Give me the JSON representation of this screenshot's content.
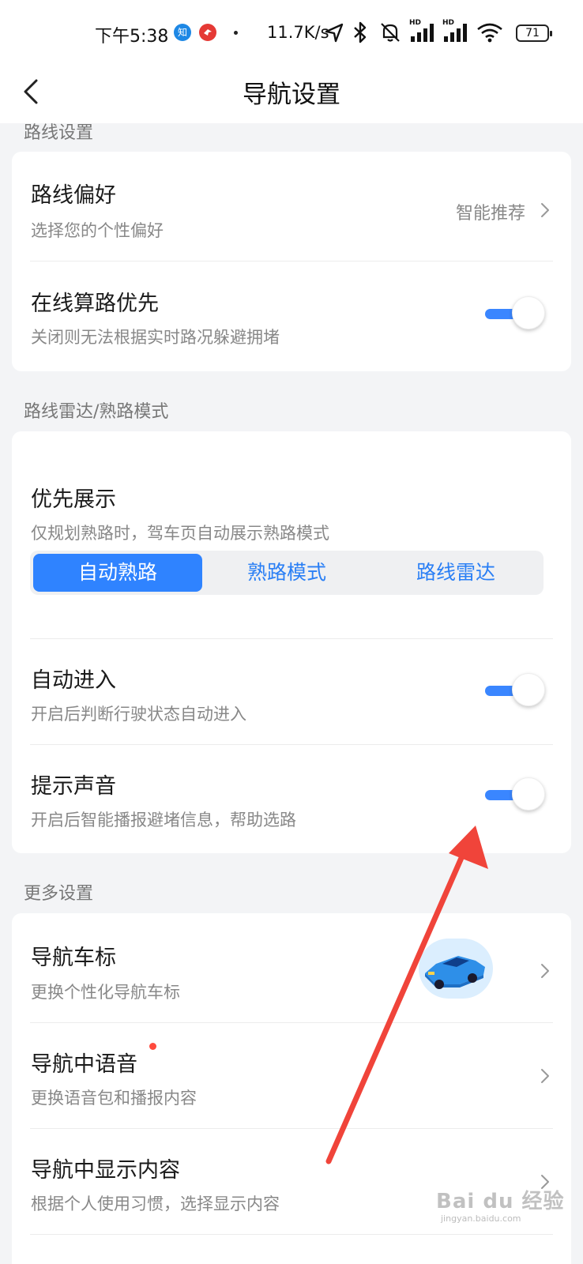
{
  "status_bar": {
    "time": "下午5:38",
    "badge1": "知",
    "network_speed": "11.7K/s",
    "hd_label": "HD",
    "battery": "71"
  },
  "app_bar": {
    "title": "导航设置",
    "back_icon": "back-chevron-icon"
  },
  "sections": {
    "route": {
      "title": "路线设置",
      "pref_title": "路线偏好",
      "pref_sub": "选择您的个性偏好",
      "pref_value": "智能推荐",
      "online_title": "在线算路优先",
      "online_sub": "关闭则无法根据实时路况躲避拥堵",
      "online_on": true
    },
    "radar": {
      "title": "路线雷达/熟路模式",
      "priority_title": "优先展示",
      "priority_sub": "仅规划熟路时，驾车页自动展示熟路模式",
      "options": [
        "自动熟路",
        "熟路模式",
        "路线雷达"
      ],
      "selected": "自动熟路",
      "auto_title": "自动进入",
      "auto_sub": "开启后判断行驶状态自动进入",
      "auto_on": true,
      "sound_title": "提示声音",
      "sound_sub": "开启后智能播报避堵信息，帮助选路",
      "sound_on": true
    },
    "more": {
      "title": "更多设置",
      "car_title": "导航车标",
      "car_sub": "更换个性化导航车标",
      "voice_title": "导航中语音",
      "voice_sub": "更换语音包和播报内容",
      "display_title": "导航中显示内容",
      "display_sub": "根据个人使用习惯，选择显示内容"
    }
  },
  "watermark": {
    "text": "Bai du 经验",
    "sub": "jingyan.baidu.com"
  },
  "colors": {
    "accent": "#2f83ff",
    "toggle_track": "#3a86ff",
    "annotation_arrow": "#f0443a",
    "new_dot": "#ff4a3d"
  }
}
